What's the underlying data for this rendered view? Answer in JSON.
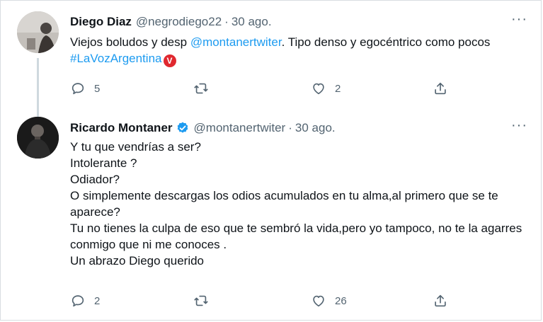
{
  "tweets": [
    {
      "name": "Diego Diaz",
      "handle": "@negrodiego22",
      "separator": "·",
      "date": "30 ago.",
      "text_part1": "Viejos boludos y desp ",
      "mention": "@montanertwiter",
      "text_part2": ". Tipo denso y egocéntrico como pocos ",
      "hashtag": "#LaVozArgentina",
      "hashtag_emoji": "V",
      "more": "···",
      "reply_count": "5",
      "retweet_count": "",
      "like_count": "2"
    },
    {
      "name": "Ricardo Montaner",
      "handle": "@montanertwiter",
      "separator": "·",
      "date": "30 ago.",
      "lines": [
        "Y tu que vendrías a ser?",
        "Intolerante ?",
        "Odiador?",
        "O simplemente descargas los odios acumulados en tu alma,al primero que se te aparece?",
        "Tu no tienes la culpa de eso que te sembró la vida,pero yo tampoco, no te la agarres conmigo que ni me conoces .",
        "Un abrazo Diego querido"
      ],
      "more": "···",
      "reply_count": "2",
      "retweet_count": "",
      "like_count": "26"
    }
  ],
  "colors": {
    "accent": "#1d9bf0",
    "muted": "#536471",
    "text": "#0f1419",
    "verified": "#1d9bf0",
    "thread_line": "#cfd9de"
  },
  "icons": [
    "reply-icon",
    "retweet-icon",
    "like-icon",
    "share-icon",
    "verified-badge-icon",
    "more-icon"
  ]
}
